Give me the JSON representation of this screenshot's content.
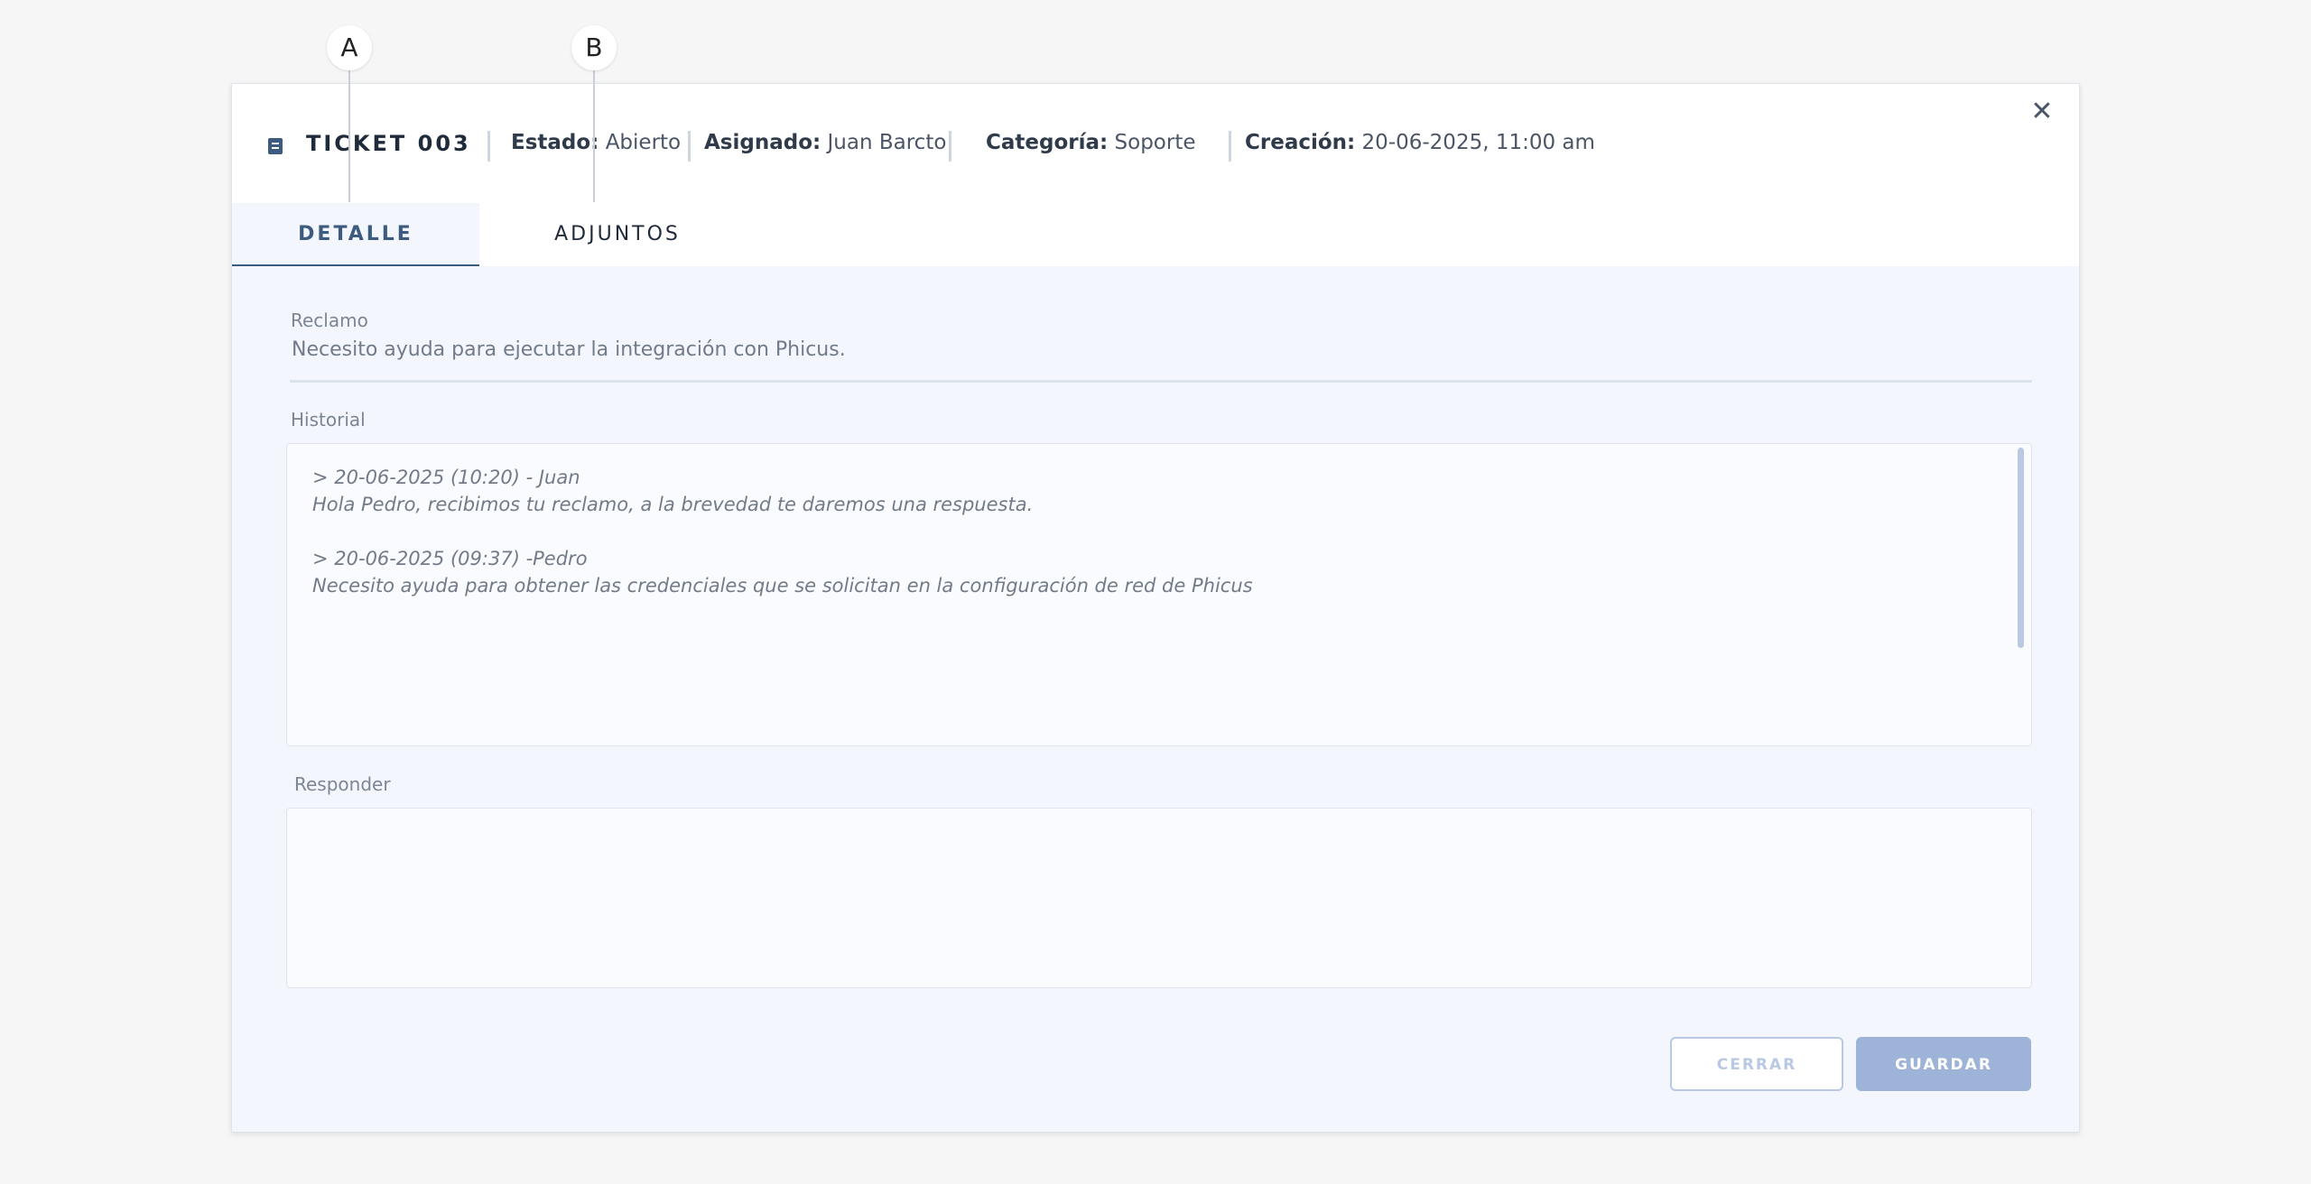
{
  "callouts": {
    "a": "A",
    "b": "B"
  },
  "header": {
    "ticket_icon": "document-icon",
    "title": "TICKET 003",
    "estado_label": "Estado:",
    "estado_value": "Abierto",
    "asignado_label": "Asignado:",
    "asignado_value": "Juan Barcto",
    "categoria_label": "Categoría:",
    "categoria_value": "Soporte",
    "creacion_label": "Creación:",
    "creacion_value": "20-06-2025, 11:00 am",
    "close_icon": "close-icon",
    "close_glyph": "✕"
  },
  "tabs": [
    {
      "label": "DETALLE",
      "active": true
    },
    {
      "label": "ADJUNTOS",
      "active": false
    }
  ],
  "reclamo": {
    "label": "Reclamo",
    "value": "Necesito ayuda para ejecutar la integración con Phicus."
  },
  "historial": {
    "label": "Historial",
    "entries": [
      {
        "header": "> 20-06-2025 (10:20) - Juan",
        "text": "Hola Pedro, recibimos tu reclamo, a la brevedad te daremos una respuesta."
      },
      {
        "header": "> 20-06-2025 (09:37) -Pedro",
        "text": "Necesito ayuda para obtener las credenciales que se solicitan en la configuración de red de Phicus"
      }
    ]
  },
  "responder": {
    "label": "Responder",
    "value": ""
  },
  "actions": {
    "cerrar": "CERRAR",
    "guardar": "GUARDAR"
  },
  "colors": {
    "accent": "#3d5a80",
    "button_primary": "#9db3d8",
    "panel_background": "#f3f6fc"
  }
}
